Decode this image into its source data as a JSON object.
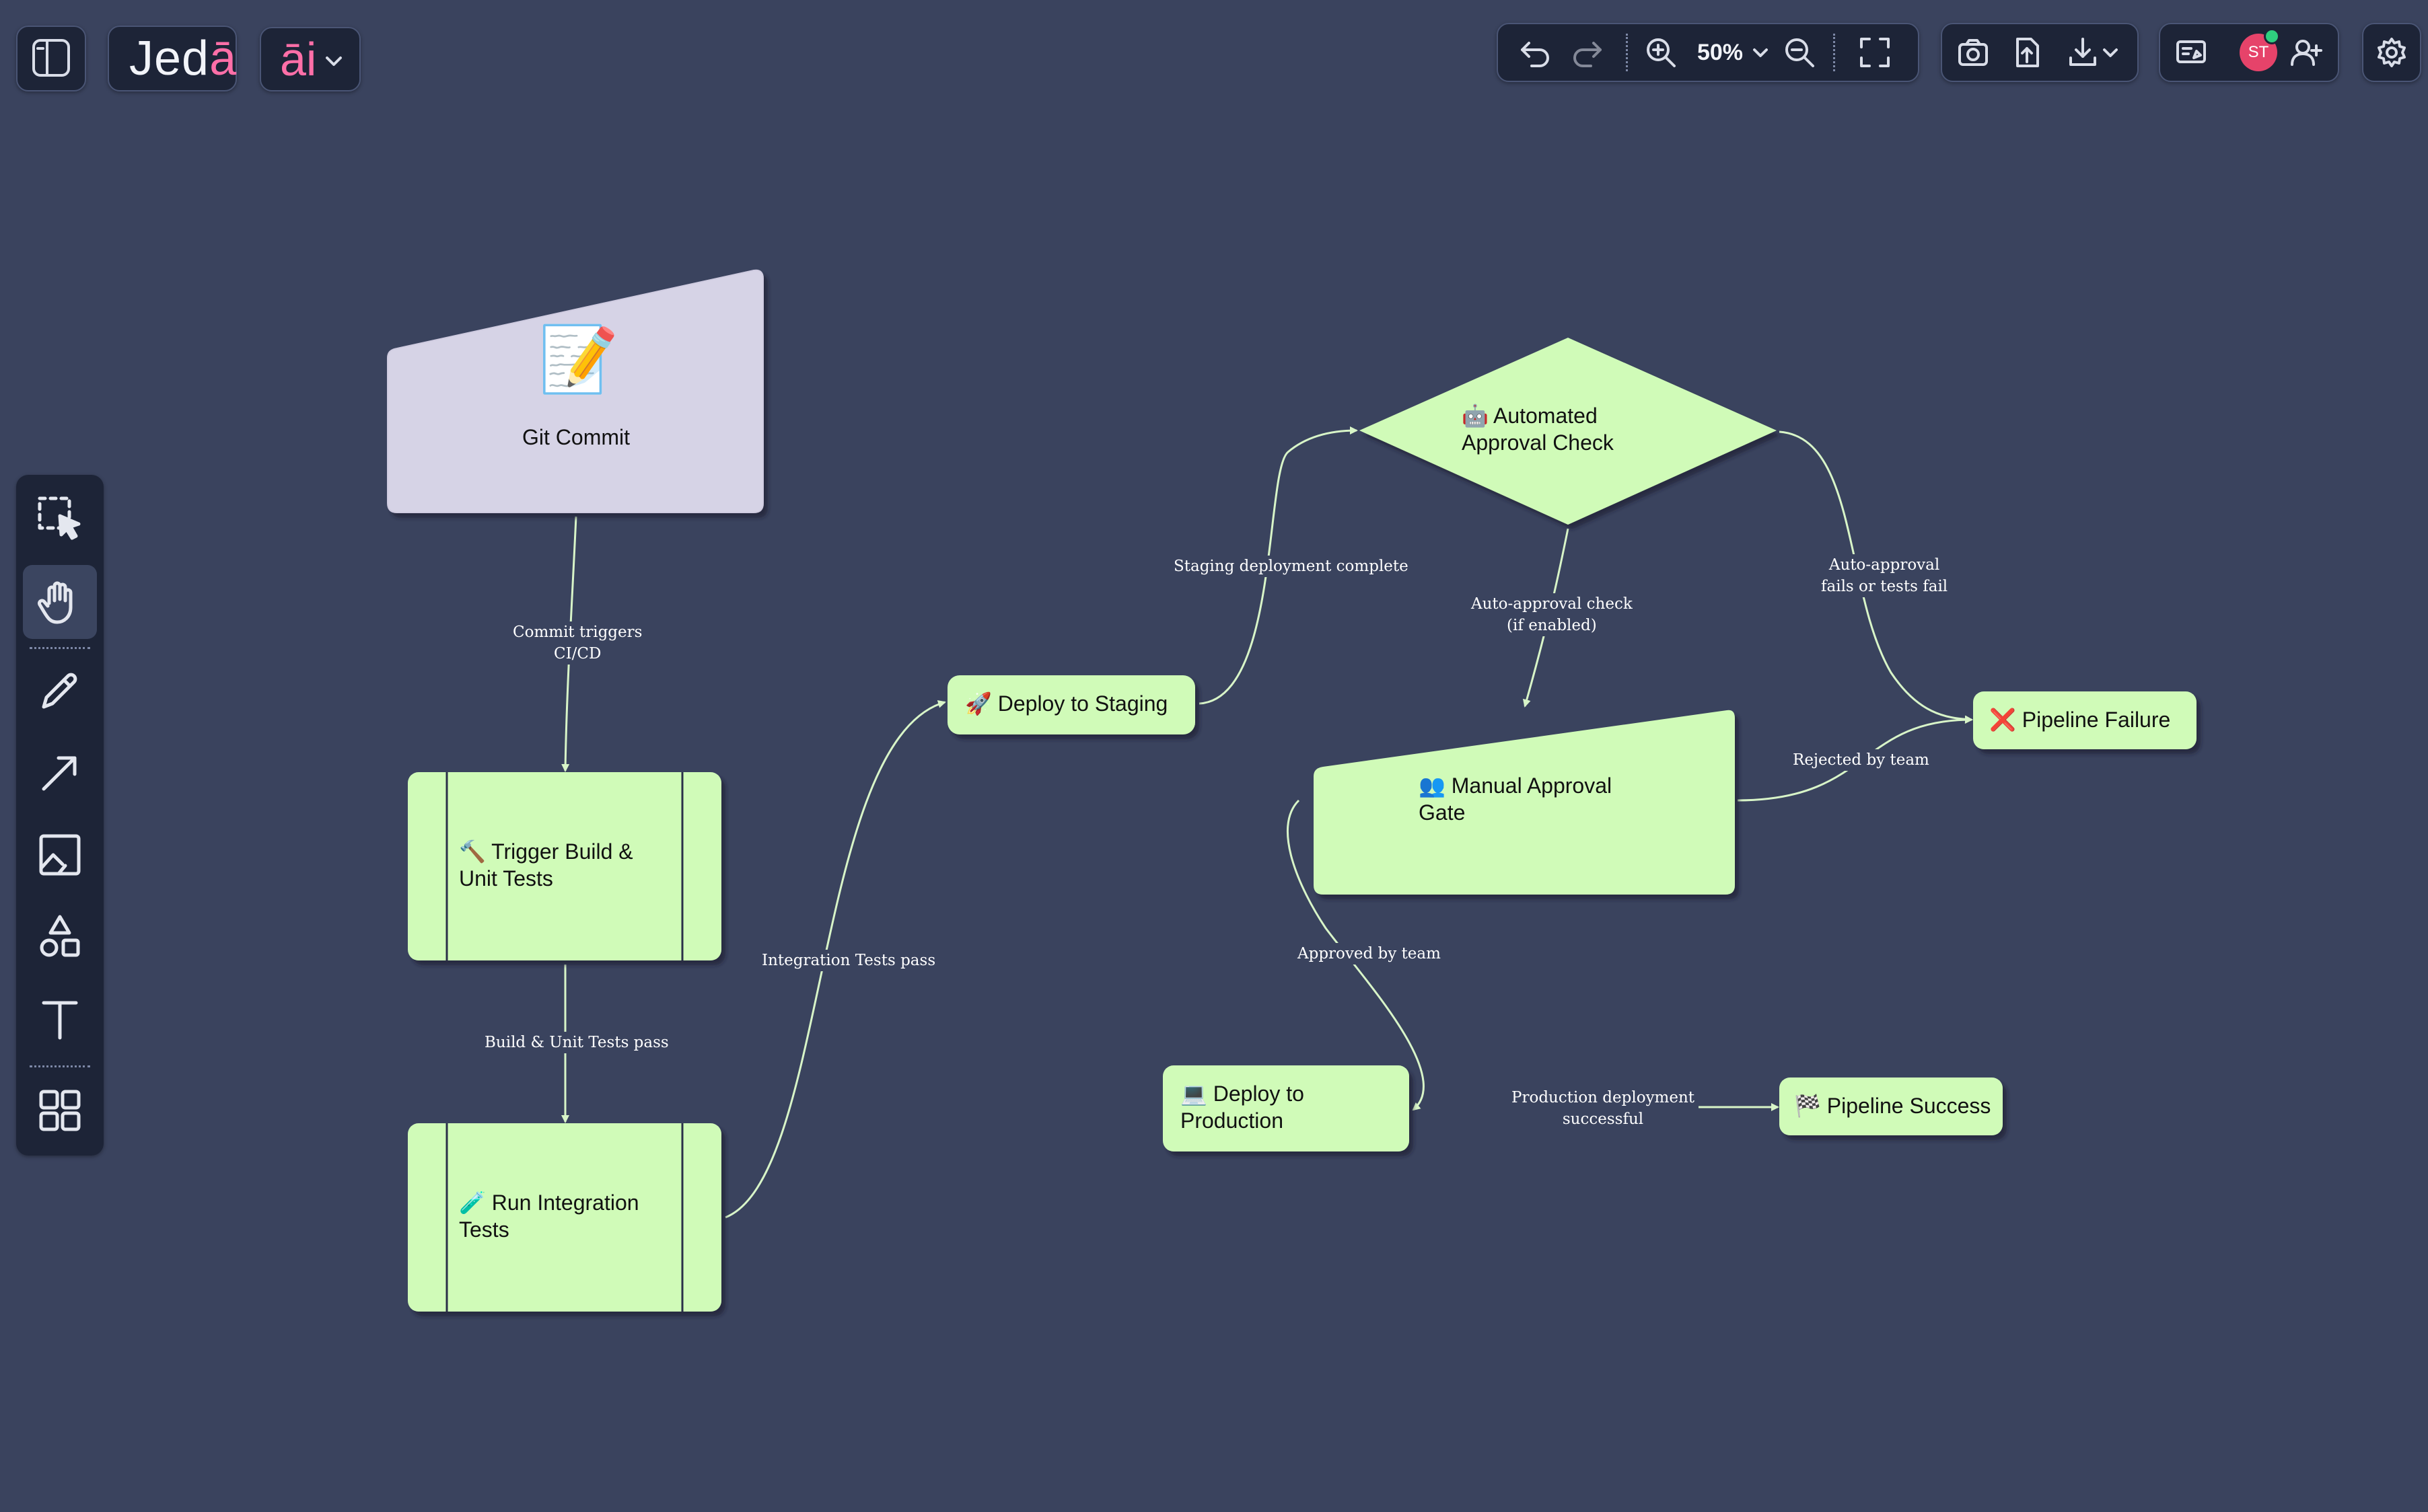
{
  "app": {
    "brand": "Jedā",
    "brand_main": "Jed",
    "brand_accent": "ā",
    "ai_label": "āi"
  },
  "toolbar": {
    "zoom": "50%",
    "avatar_initials": "ST"
  },
  "left_toolbar": {
    "tools": [
      "select",
      "hand",
      "pen",
      "arrow",
      "image",
      "shapes",
      "text",
      "templates"
    ],
    "active": "hand"
  },
  "diagram": {
    "nodes": {
      "git_commit": {
        "icon": "📝",
        "label": "Git Commit"
      },
      "trigger_build": {
        "label": "🔨 Trigger Build &\nUnit Tests"
      },
      "run_integration": {
        "label": "🧪 Run Integration\nTests"
      },
      "deploy_staging": {
        "label": "🚀 Deploy to Staging"
      },
      "auto_approval": {
        "label": "🤖 Automated\nApproval Check"
      },
      "manual_gate": {
        "label": "👥 Manual Approval\nGate"
      },
      "pipeline_failure": {
        "label": "❌ Pipeline Failure"
      },
      "deploy_production": {
        "label": "💻 Deploy to\nProduction"
      },
      "pipeline_success": {
        "label": "🏁 Pipeline Success"
      }
    },
    "edges": {
      "commit_triggers": "Commit triggers\nCI/CD",
      "build_pass": "Build & Unit Tests pass",
      "integration_pass": "Integration Tests pass",
      "staging_complete": "Staging deployment complete",
      "auto_check": "Auto-approval check\n(if enabled)",
      "auto_fail": "Auto-approval\nfails or tests fail",
      "rejected": "Rejected by team",
      "approved": "Approved by team",
      "prod_success": "Production deployment\nsuccessful"
    }
  },
  "colors": {
    "background": "#3a435e",
    "node_green": "#d0fbb8",
    "node_purple": "#d6d3e6",
    "edge": "#d8f5c8",
    "avatar": "#e6436a"
  }
}
